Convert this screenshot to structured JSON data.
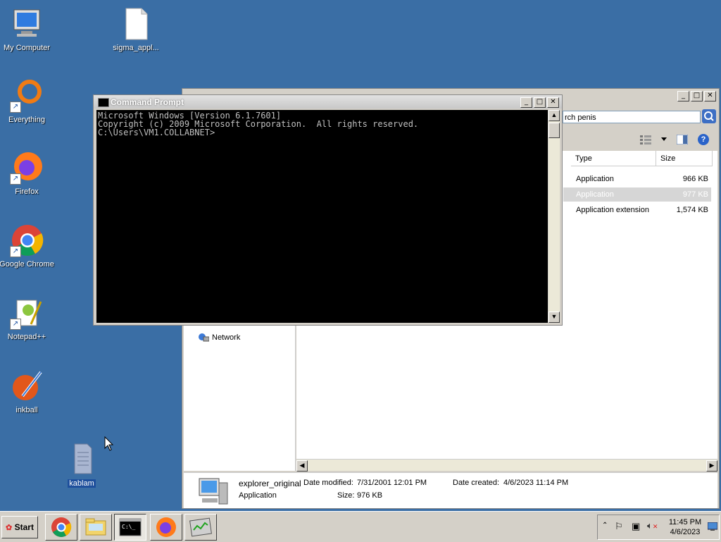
{
  "desktop": {
    "icons": [
      {
        "label": "My Computer"
      },
      {
        "label": "sigma_appl..."
      },
      {
        "label": "Everything"
      },
      {
        "label": "Firefox"
      },
      {
        "label": "Google Chrome"
      },
      {
        "label": "Notepad++"
      },
      {
        "label": "inkball"
      },
      {
        "label": "kablam"
      }
    ]
  },
  "explorer": {
    "search_text": "rch penis",
    "columns": {
      "type": "Type",
      "size": "Size"
    },
    "rows": [
      {
        "type": "Application",
        "size": "966 KB"
      },
      {
        "type": "Application",
        "size": "977 KB"
      },
      {
        "type": "Application extension",
        "size": "1,574 KB"
      }
    ],
    "nav": {
      "network": "Network"
    },
    "details": {
      "name": "explorer_original",
      "type": "Application",
      "modified_label": "Date modified:",
      "modified_value": "7/31/2001 12:01 PM",
      "created_label": "Date created:",
      "created_value": "4/6/2023 11:14 PM",
      "size_label": "Size:",
      "size_value": "976 KB"
    }
  },
  "cmd": {
    "title": "Command Prompt",
    "lines": [
      "Microsoft Windows [Version 6.1.7601]",
      "Copyright (c) 2009 Microsoft Corporation.  All rights reserved.",
      "",
      "C:\\Users\\VM1.COLLABNET>"
    ]
  },
  "taskbar": {
    "start_label": "Start",
    "time": "11:45 PM",
    "date": "4/6/2023"
  },
  "colors": {
    "desktop": "#3a6ea5",
    "selection": "#1e4f9c"
  }
}
